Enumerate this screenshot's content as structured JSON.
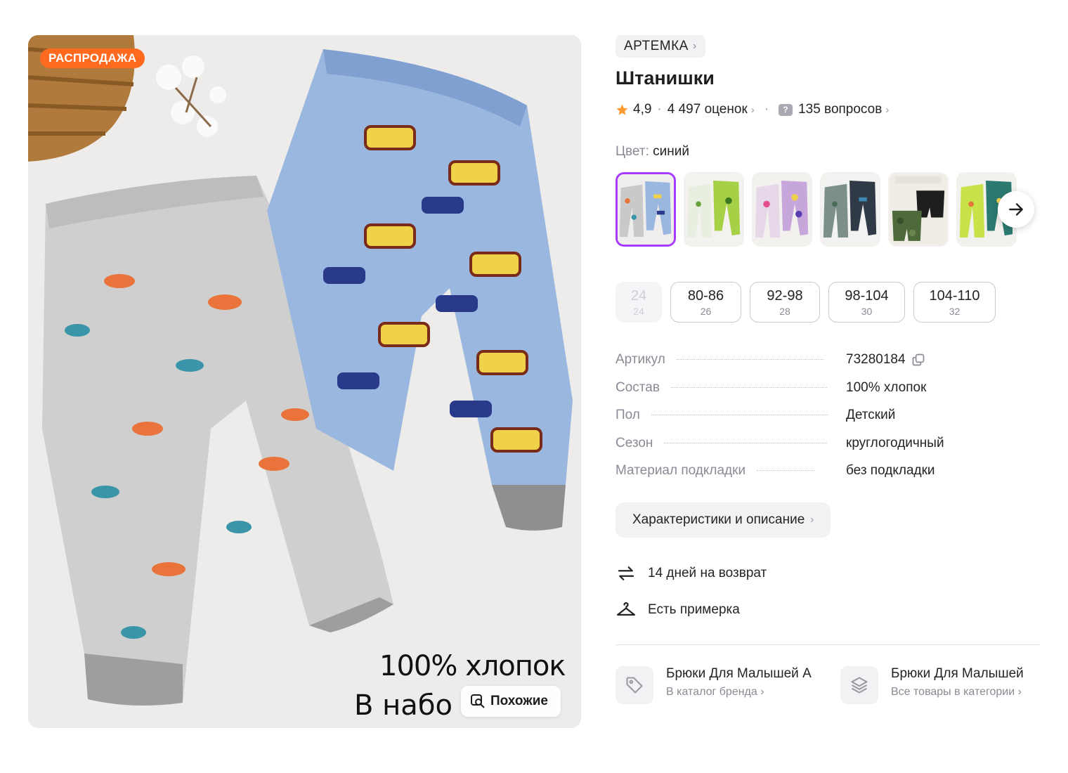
{
  "gallery": {
    "sale_badge": "РАСПРОДАЖА",
    "caption_line1": "100% хлопок",
    "caption_line2": "В набо",
    "similar_button": "Похожие"
  },
  "product": {
    "brand": "АРТЕМКА",
    "title": "Штанишки",
    "rating": "4,9",
    "reviews": "4 497 оценок",
    "questions": "135 вопросов",
    "color_label": "Цвет:",
    "color_value": "синий",
    "colors_count": 6
  },
  "sizes": [
    {
      "main": "24",
      "sub": "24",
      "available": false
    },
    {
      "main": "80-86",
      "sub": "26",
      "available": true
    },
    {
      "main": "92-98",
      "sub": "28",
      "available": true
    },
    {
      "main": "98-104",
      "sub": "30",
      "available": true
    },
    {
      "main": "104-110",
      "sub": "32",
      "available": true
    }
  ],
  "specs": [
    {
      "key": "Артикул",
      "value": "73280184"
    },
    {
      "key": "Состав",
      "value": "100% хлопок"
    },
    {
      "key": "Пол",
      "value": "Детский"
    },
    {
      "key": "Сезон",
      "value": "круглогодичный"
    },
    {
      "key": "Материал подкладки",
      "value": "без подкладки"
    }
  ],
  "description_button": "Характеристики и описание",
  "features": {
    "return": "14 дней на возврат",
    "fitting": "Есть примерка"
  },
  "links": [
    {
      "title": "Брюки Для Малышей А",
      "subtitle": "В каталог бренда"
    },
    {
      "title": "Брюки Для Малышей",
      "subtitle": "Все товары в категории"
    }
  ],
  "colors": {
    "accent": "#a73afd",
    "sale": "#ff6a1f"
  }
}
